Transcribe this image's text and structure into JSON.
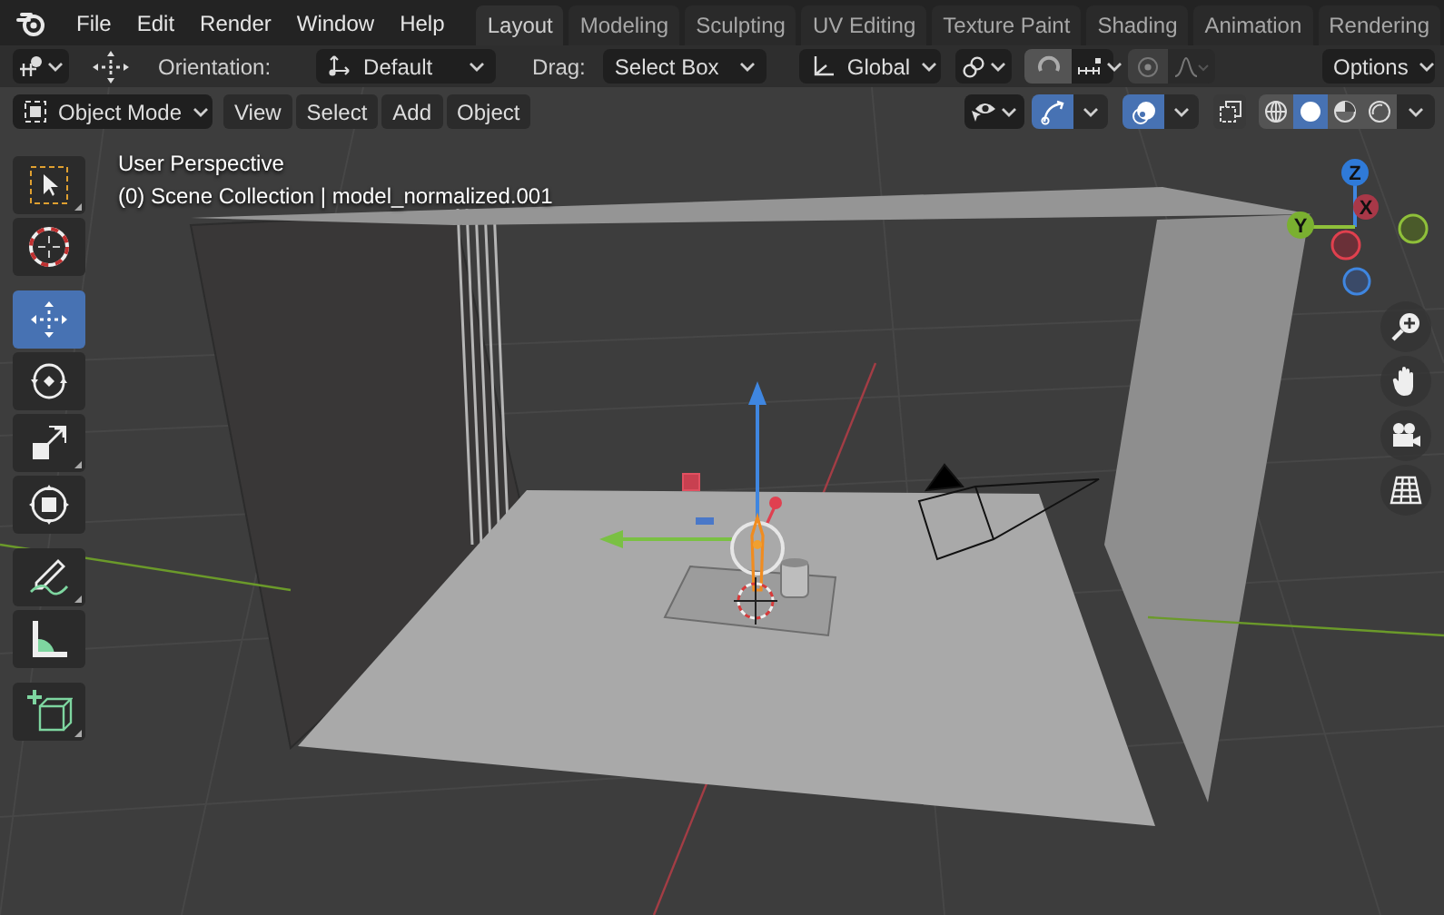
{
  "menu": [
    "File",
    "Edit",
    "Render",
    "Window",
    "Help"
  ],
  "workspaces": [
    {
      "label": "Layout",
      "selected": true
    },
    {
      "label": "Modeling",
      "selected": false
    },
    {
      "label": "Sculpting",
      "selected": false
    },
    {
      "label": "UV Editing",
      "selected": false
    },
    {
      "label": "Texture Paint",
      "selected": false
    },
    {
      "label": "Shading",
      "selected": false
    },
    {
      "label": "Animation",
      "selected": false
    },
    {
      "label": "Rendering",
      "selected": false
    }
  ],
  "tool_header": {
    "orientation_label": "Orientation:",
    "orientation": "Default",
    "drag_label": "Drag:",
    "drag": "Select Box",
    "transform_orientation": "Global",
    "snap_on": false,
    "proportional_on": false,
    "options": "Options"
  },
  "viewport_header": {
    "mode": "Object Mode",
    "menus": [
      "View",
      "Select",
      "Add",
      "Object"
    ],
    "gizmos_on": true,
    "overlays_on": true,
    "xray_on": false,
    "shading": [
      {
        "kind": "wireframe",
        "selected": false
      },
      {
        "kind": "solid",
        "selected": true
      },
      {
        "kind": "material",
        "selected": false
      },
      {
        "kind": "rendered",
        "selected": false
      }
    ]
  },
  "viewport_info": {
    "view": "User Perspective",
    "collection": "(0) Scene Collection | model_normalized.001"
  },
  "tool_groups": [
    {
      "tools": [
        {
          "kind": "select_box",
          "selected": false
        },
        {
          "kind": "cursor",
          "selected": false
        }
      ]
    },
    {
      "tools": [
        {
          "kind": "move",
          "selected": true
        },
        {
          "kind": "rotate",
          "selected": false
        },
        {
          "kind": "scale",
          "selected": false
        },
        {
          "kind": "transform",
          "selected": false
        }
      ]
    },
    {
      "tools": [
        {
          "kind": "annotate",
          "selected": false
        },
        {
          "kind": "measure",
          "selected": false
        }
      ]
    },
    {
      "tools": [
        {
          "kind": "add_cube",
          "selected": false
        }
      ]
    }
  ],
  "axis_gizmo": {
    "z": "Z",
    "x": "X",
    "y": "Y"
  },
  "navigation": [
    {
      "kind": "zoom"
    },
    {
      "kind": "pan"
    },
    {
      "kind": "camera"
    },
    {
      "kind": "grid"
    }
  ]
}
